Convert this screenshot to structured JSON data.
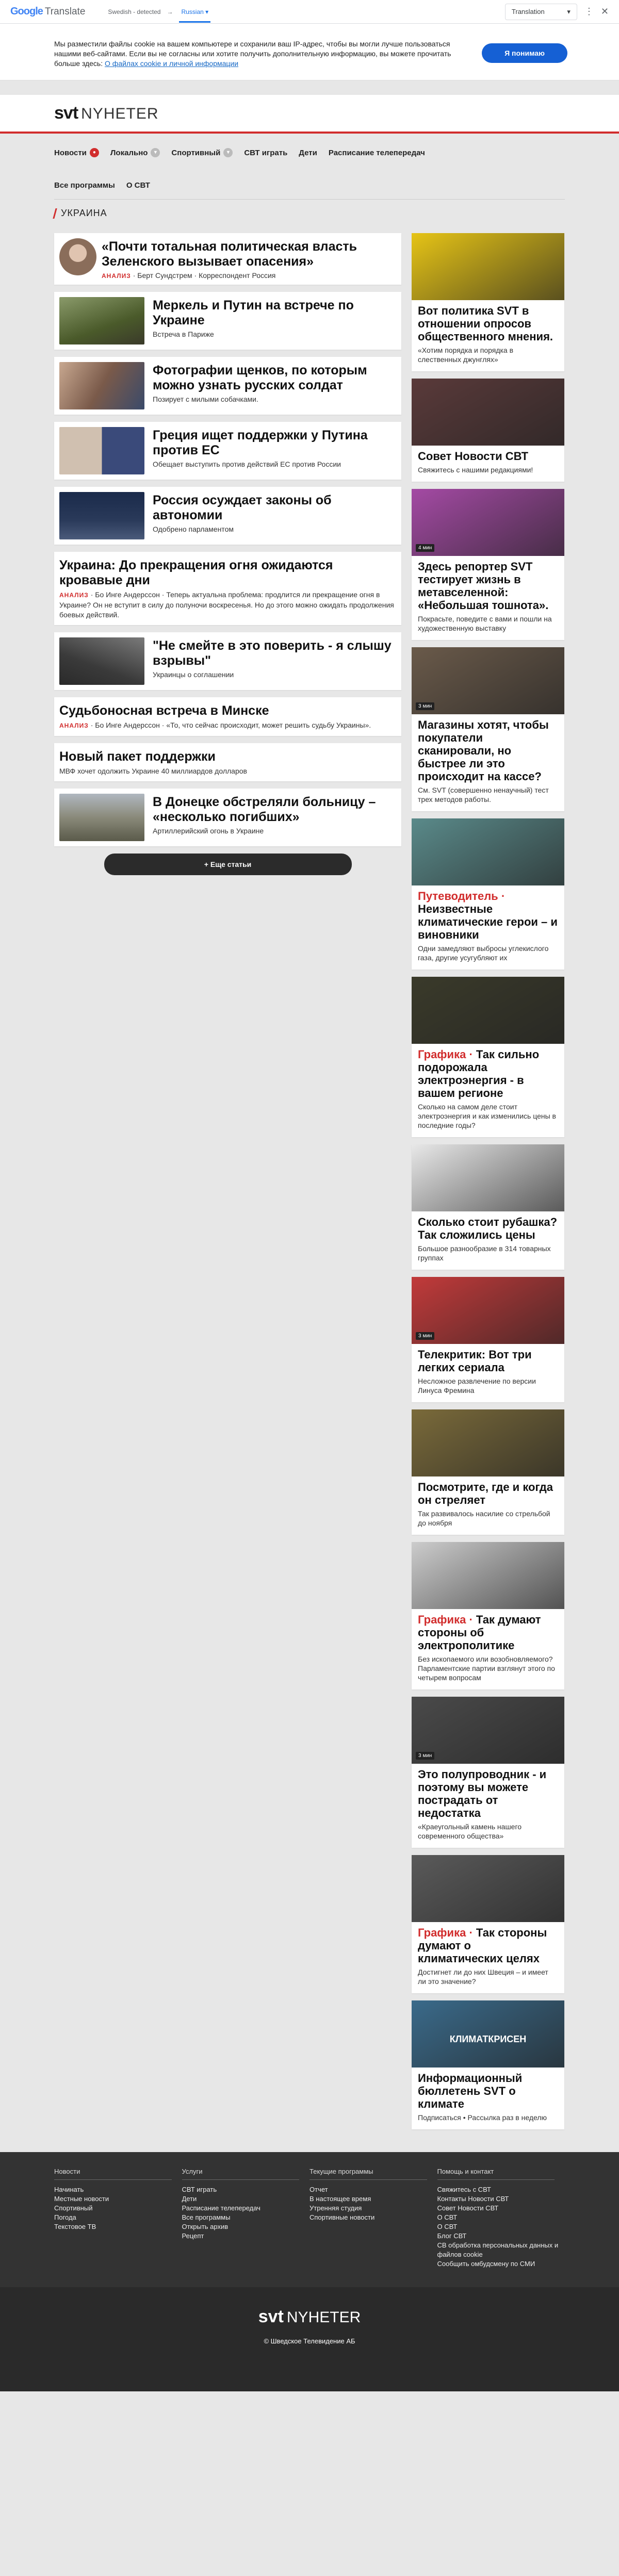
{
  "translate_bar": {
    "logo_google": "Google",
    "logo_translate": "Translate",
    "source_lang": "Swedish - detected",
    "arrow": "→",
    "target_lang": "Russian",
    "target_chevron": "▾",
    "translation_button": "Translation",
    "translation_chevron": "▾",
    "more": "⋮",
    "close": "✕"
  },
  "cookie": {
    "text": "Мы разместили файлы cookie на вашем компьютере и сохранили ваш IP-адрес, чтобы вы могли лучше пользоваться нашими веб-сайтами. Если вы не согласны или хотите получить дополнительную информацию, вы можете прочитать больше здесь:",
    "link": "О файлах cookie и личной информации",
    "button": "Я понимаю"
  },
  "header": {
    "logo_svt": "svt",
    "logo_nyheter": "NYHETER"
  },
  "nav": {
    "row1": [
      {
        "label": "Новости",
        "badge": "●",
        "badge_style": "red"
      },
      {
        "label": "Локально",
        "badge": "▾",
        "badge_style": "grey"
      },
      {
        "label": "Спортивный",
        "badge": "▾",
        "badge_style": "grey"
      },
      {
        "label": "СВТ играть",
        "badge": "",
        "badge_style": ""
      },
      {
        "label": "Дети",
        "badge": "",
        "badge_style": ""
      },
      {
        "label": "Расписание телепередач",
        "badge": "",
        "badge_style": ""
      }
    ],
    "row2": [
      "Все программы",
      "О СВТ"
    ]
  },
  "breadcrumb": "УКРАИНА",
  "articles": [
    {
      "title": "«Почти тотальная политическая власть Зеленского вызывает опасения»",
      "kicker": "АНАЛИЗ",
      "sub": "· Берт Сундстрем · Корреспондент Россия",
      "img": "round",
      "color": "#8a6d5a"
    },
    {
      "title": "Меркель и Путин на встрече по Украине",
      "sub": "Встреча в Париже",
      "img": "rect",
      "color": "#5a6a3a"
    },
    {
      "title": "Фотографии щенков, по которым можно узнать русских солдат",
      "sub": "Позирует с милыми собачками.",
      "img": "rect",
      "color": "#7a5a4a"
    },
    {
      "title": "Греция ищет поддержки у Путина против ЕС",
      "sub": "Обещает выступить против действий ЕС против России",
      "img": "rect",
      "color": "#3a4a7a"
    },
    {
      "title": "Россия осуждает законы об автономии",
      "sub": "Одобрено парламентом",
      "img": "rect",
      "color": "#2a3a5a"
    }
  ],
  "analysis_long": {
    "title": "Украина: До прекращения огня ожидаются кровавые дни",
    "kicker": "АНАЛИЗ",
    "text": "· Бо Инге Андерссон · Теперь актуальна проблема: продлится ли прекращение огня в Украине? Он не вступит в силу до полуночи воскресенья. Но до этого можно ожидать продолжения боевых действий."
  },
  "article_quote": {
    "title": "\"Не смейте в это поверить - я слышу взрывы\"",
    "sub": "Украинцы о соглашении",
    "color": "#4a4a4a"
  },
  "analysis_minsk": {
    "title": "Судьбоносная встреча в Минске",
    "kicker": "АНАЛИЗ",
    "text": "· Бо Инге Андерссон · «То, что сейчас происходит, может решить судьбу Украины»."
  },
  "support_pack": {
    "title": "Новый пакет поддержки",
    "text": "МВФ хочет одолжить Украине 40 миллиардов долларов"
  },
  "donetsk": {
    "title": "В Донецке обстреляли больницу – «несколько погибших»",
    "sub": "Артиллерийский огонь в Украине",
    "color": "#8a8a7a"
  },
  "more_button": {
    "icon": "+",
    "label": "Еще статьи"
  },
  "sidebar": [
    {
      "title": "Вот политика SVT в отношении опросов общественного мнения.",
      "kicker": "",
      "text": "«Хотим порядка и порядка в слественных джунглях»",
      "color": "#e6c416",
      "tag": ""
    },
    {
      "title": "Совет Новости СВТ",
      "kicker": "",
      "text": "Свяжитесь с нашими редакциями!",
      "color": "#5a3a3a",
      "tag": ""
    },
    {
      "title": "Здесь репортер SVT тестирует жизнь в метавселенной: «Небольшая тошнота».",
      "kicker": "",
      "text": "Покрасьте, поведите с вами и пошли на художественную выставку",
      "color": "#a44aa4",
      "tag": "4 мин"
    },
    {
      "title": "Магазины хотят, чтобы покупатели сканировали, но быстрее ли это происходит на кассе?",
      "kicker": "",
      "text": "См. SVT (совершенно ненаучный) тест трех методов работы.",
      "color": "#6a5a4a",
      "tag": "3 мин"
    },
    {
      "title": "Неизвестные климатические герои – и виновники",
      "kicker": "Путеводитель · ",
      "text": "Одни замедляют выбросы углекислого газа, другие усугубляют их",
      "color": "#5a8a8a",
      "tag": ""
    },
    {
      "title": "Так сильно подорожала электроэнергия - в вашем регионе",
      "kicker": "Графика · ",
      "text": "Сколько на самом деле стоит электроэнергия и как изменились цены в последние годы?",
      "color": "#3a3a2a",
      "tag": ""
    },
    {
      "title": "Сколько стоит рубашка? Так сложились цены",
      "kicker": "",
      "text": "Большое разнообразие в 314 товарных группах",
      "color": "#e8e8e8",
      "tag": ""
    },
    {
      "title": "Телекритик: Вот три легких сериала",
      "kicker": "",
      "text": "Несложное развлечение по версии Линуса Фремина",
      "color": "#c23a3a",
      "tag": "3 мин"
    },
    {
      "title": "Посмотрите, где и когда он стреляет",
      "kicker": "",
      "text": "Так развивалось насилие со стрельбой до ноября",
      "color": "#7a6a3a",
      "tag": ""
    },
    {
      "title": "Так думают стороны об электрополитике",
      "kicker": "Графика · ",
      "text": "Без ископаемого или возобновляемого? Парламентские партии взглянут этого по четырем вопросам",
      "color": "#cccccc",
      "tag": ""
    },
    {
      "title": "Это полупроводник - и поэтому вы можете пострадать от недостатка",
      "kicker": "",
      "text": "«Краеугольный камень нашего современного общества»",
      "color": "#4a4a4a",
      "tag": "3 мин"
    },
    {
      "title": "Так стороны думают о климатических целях",
      "kicker": "Графика · ",
      "text": "Достигнет ли до них Швеция – и имеет ли это значение?",
      "color": "#5a5a5a",
      "tag": ""
    },
    {
      "title": "Информационный бюллетень SVT о климате",
      "kicker": "",
      "text": "Подписаться • Рассылка раз в неделю",
      "color": "#3a6a8a",
      "tag": ""
    }
  ],
  "sidebar_klimat": "КЛИМАТКРИСЕН",
  "footer": {
    "columns": [
      {
        "title": "Новости",
        "items": [
          "Начинать",
          "Местные новости",
          "Спортивный",
          "Погода",
          "Текстовое ТВ"
        ]
      },
      {
        "title": "Услуги",
        "items": [
          "СВТ играть",
          "Дети",
          "Расписание телепередач",
          "Все программы",
          "Открыть архив",
          "Рецепт"
        ]
      },
      {
        "title": "Текущие программы",
        "items": [
          "Отчет",
          "В настоящее время",
          "Утренняя студия",
          "Спортивные новости"
        ]
      },
      {
        "title": "Помощь и контакт",
        "items": [
          "Свяжитесь с СВТ",
          "Контакты Новости СВТ",
          "Совет Новости СВТ",
          "О СВТ",
          "О СВТ",
          "Блог СВТ",
          "СВ обработка персональных данных и файлов cookie",
          "Сообщить омбудсмену по СМИ"
        ]
      }
    ],
    "copyright": "© Шведское Телевидение АБ"
  }
}
